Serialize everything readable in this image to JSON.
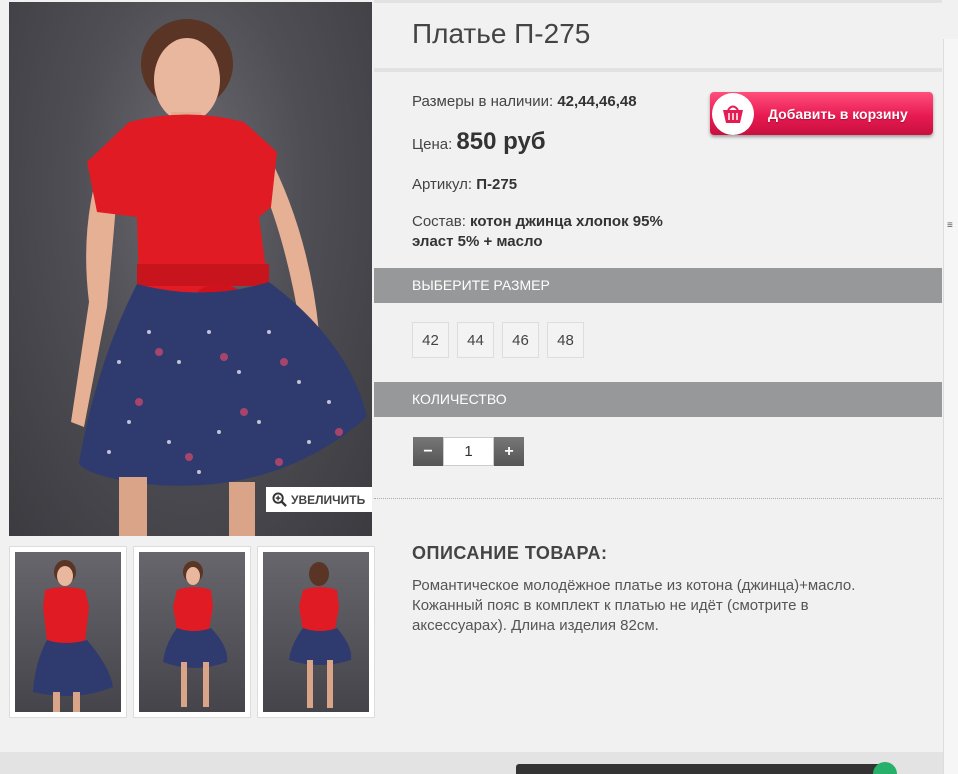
{
  "product": {
    "title": "Платье П-275",
    "sizes_label": "Размеры в наличии:",
    "sizes_value": "42,44,46,48",
    "price_label": "Цена:",
    "price_value": "850 руб",
    "sku_label": "Артикул:",
    "sku_value": "П-275",
    "composition_label": "Состав:",
    "composition_line1": "котон джинца хлопок 95%",
    "composition_line2": "эласт 5% + масло"
  },
  "cart_button": {
    "label": "Добавить в корзину",
    "icon": "basket-icon"
  },
  "zoom_button": {
    "label": "УВЕЛИЧИТЬ",
    "icon": "zoom-in-icon"
  },
  "size_section": {
    "title": "ВЫБЕРИТЕ РАЗМЕР",
    "options": [
      "42",
      "44",
      "46",
      "48"
    ]
  },
  "quantity_section": {
    "title": "КОЛИЧЕСТВО",
    "value": "1",
    "minus": "−",
    "plus": "+"
  },
  "description": {
    "title": "ОПИСАНИЕ ТОВАРА:",
    "line1": "Романтическое молодёжное платье из котона (джинца)+масло.",
    "line2": "Кожанный пояс в комплект к платью не идёт (смотрите в",
    "line3": "аксессуарах). Длина изделия 82см."
  },
  "colors": {
    "cart_button": "#e81a52",
    "section_bar": "#979899",
    "dress_top": "#e01b24",
    "skirt": "#2f3b6e"
  }
}
